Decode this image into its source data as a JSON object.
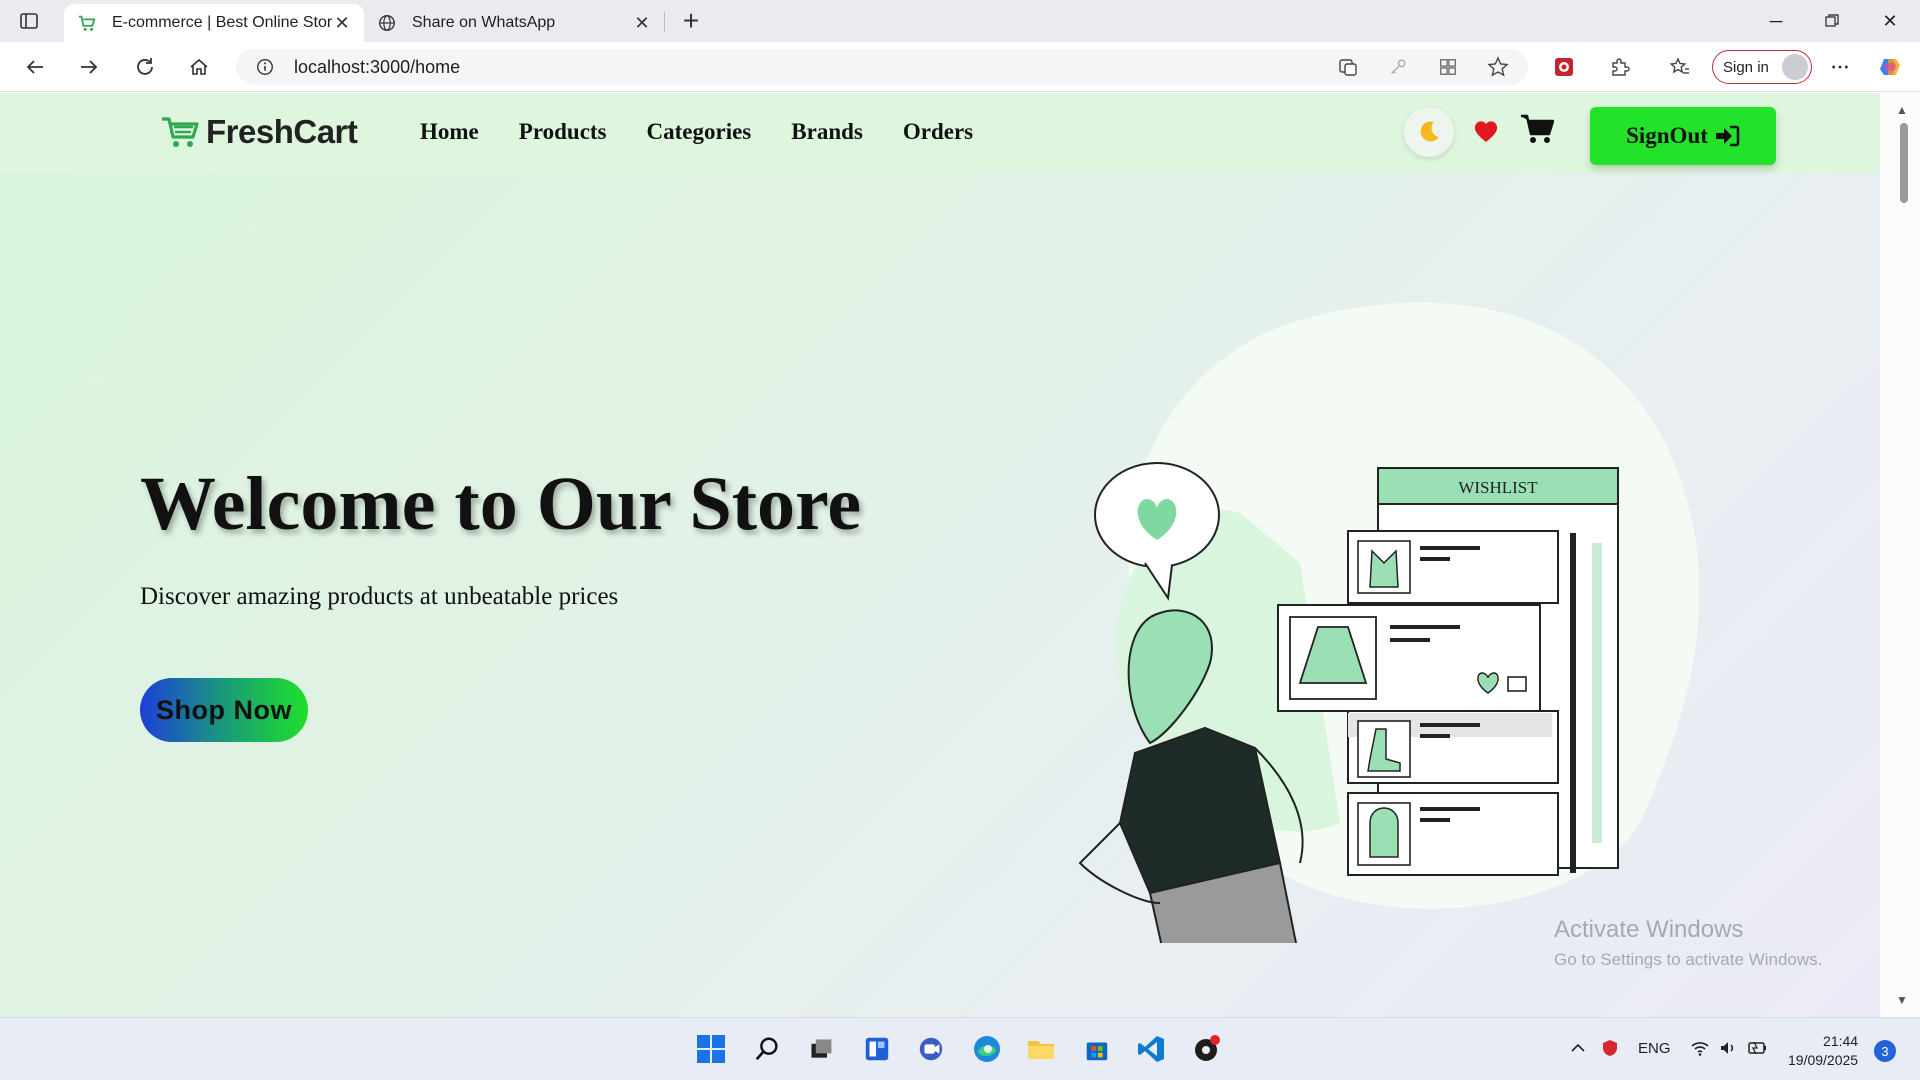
{
  "browser": {
    "tabs": [
      {
        "title": "E-commerce | Best Online Store",
        "active": true
      },
      {
        "title": "Share on WhatsApp",
        "active": false
      }
    ],
    "url": "localhost:3000/home",
    "signin_label": "Sign in"
  },
  "site": {
    "brand": "FreshCart",
    "nav": [
      "Home",
      "Products",
      "Categories",
      "Brands",
      "Orders"
    ],
    "signout_label": "SignOut",
    "hero": {
      "title": "Welcome to Our Store",
      "subtitle": "Discover amazing products at unbeatable prices",
      "cta": "Shop Now"
    },
    "illustration": {
      "wishlist_label": "WISHLIST"
    },
    "colors": {
      "accent": "#22e22a",
      "illustration_green": "#7ed8a0"
    }
  },
  "os": {
    "activate_title": "Activate Windows",
    "activate_sub": "Go to Settings to activate Windows.",
    "tray_lang": "ENG",
    "time": "21:44",
    "date": "19/09/2025",
    "notifications": "3"
  }
}
